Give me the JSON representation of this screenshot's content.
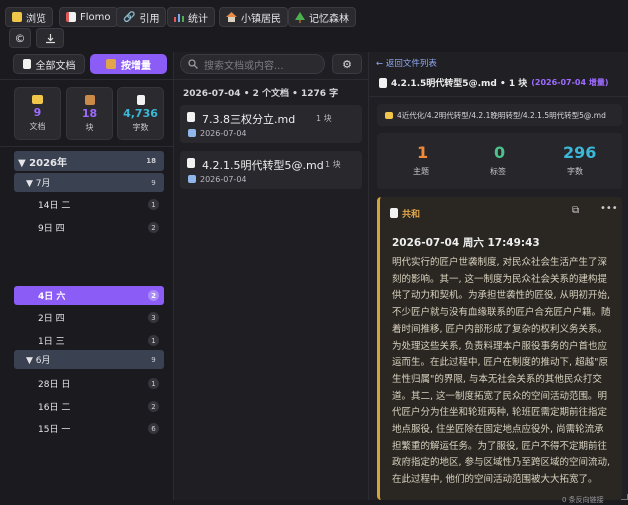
{
  "toolbar": {
    "buttons": [
      {
        "label": "浏览",
        "icon": "folder-icon",
        "color": "#f0c64a"
      },
      {
        "label": "Flomo",
        "icon": "memo-icon",
        "color": "#e05a5a"
      },
      {
        "label": "引用",
        "icon": "link-icon",
        "color": "#dcdcdc"
      },
      {
        "label": "统计",
        "icon": "bar-chart-icon",
        "color": "#7aa7f0"
      },
      {
        "label": "小镇居民",
        "icon": "house-icon",
        "color": "#e58b4a"
      },
      {
        "label": "记忆森林",
        "icon": "tree-icon",
        "color": "#4caf50"
      }
    ],
    "icon_buttons": [
      "copyright-icon",
      "download-icon"
    ]
  },
  "left": {
    "tabs": {
      "all_docs": "全部文档",
      "by_increment": "按增量"
    },
    "stats": [
      {
        "value": "9",
        "label": "文档",
        "color": "#9d6bff",
        "icon": "folder-icon"
      },
      {
        "value": "18",
        "label": "块",
        "color": "#9d6bff",
        "icon": "box-icon"
      },
      {
        "value": "4,736",
        "label": "字数",
        "color": "#3bb8d8",
        "icon": "document-icon"
      }
    ],
    "tree": {
      "year": {
        "label": "▼ 2026年",
        "count": "18"
      },
      "months": [
        {
          "label": "▼ 7月",
          "count": "9",
          "days": [
            {
              "label": "14日 二",
              "count": "1"
            },
            {
              "label": "9日 四",
              "count": "2"
            },
            {
              "label": "4日 六",
              "count": "2",
              "selected": true
            },
            {
              "label": "2日 四",
              "count": "3"
            },
            {
              "label": "1日 三",
              "count": "1"
            }
          ]
        },
        {
          "label": "▼ 6月",
          "count": "9",
          "days": [
            {
              "label": "28日 日",
              "count": "1"
            },
            {
              "label": "16日 二",
              "count": "2"
            },
            {
              "label": "15日 一",
              "count": "6"
            }
          ]
        }
      ]
    }
  },
  "middle": {
    "search_placeholder": "搜索文档或内容...",
    "summary": "2026-07-04 • 2 个文档 • 1276 字",
    "docs": [
      {
        "title": "7.3.8三权分立.md",
        "blocks": "1 块",
        "date": "2026-07-04"
      },
      {
        "title": "4.2.1.5明代转型5@.md",
        "blocks": "1 块",
        "date": "2026-07-04"
      }
    ]
  },
  "right": {
    "back_link": "← 返回文件列表",
    "doc_title": "4.2.1.5明代转型5@.md • 1 块",
    "doc_date": "(2026-07-04 增量)",
    "path": "4近代化/4.2明代转型/4.2.1晚明转型/4.2.1.5明代转型5@.md",
    "stats": [
      {
        "value": "1",
        "label": "主题",
        "color": "#f08a3a"
      },
      {
        "value": "0",
        "label": "标签",
        "color": "#4cc38a"
      },
      {
        "value": "296",
        "label": "字数",
        "color": "#3bb8d8"
      }
    ],
    "note": {
      "tag": "共和",
      "tag_color": "#e0a54a",
      "timestamp": "2026-07-04 周六 17:49:43",
      "body": "明代实行的匠户世袭制度, 对民众社会生活产生了深刻的影响。其一, 这一制度为民众社会关系的建构提供了动力和契机。为承担世袭性的匠役, 从明初开始, 不少匠户就与没有血缘联系的匠户合充匠户户籍。随着时间推移, 匠户内部形成了复杂的权利义务关系。为处理这些关系, 负责料理本户服役事务的户首也应运而生。在此过程中, 匠户在制度的推动下, 超越\"原生性归属\"的界限, 与本无社会关系的其他民众打交道。其二, 这一制度拓宽了民众的空间活动范围。明代匠户分为住坐和轮班两种, 轮班匠需定期前往指定地点服役, 住坐匠除在固定地点应役外, 尚需轮流承担繁重的解运任务。为了服役, 匠户不得不定期前往政府指定的地区, 参与区域性乃至跨区域的空间流动, 在此过程中, 他们的空间活动范围被大大拓宽了。"
    },
    "footer": "0 条反向链接"
  }
}
